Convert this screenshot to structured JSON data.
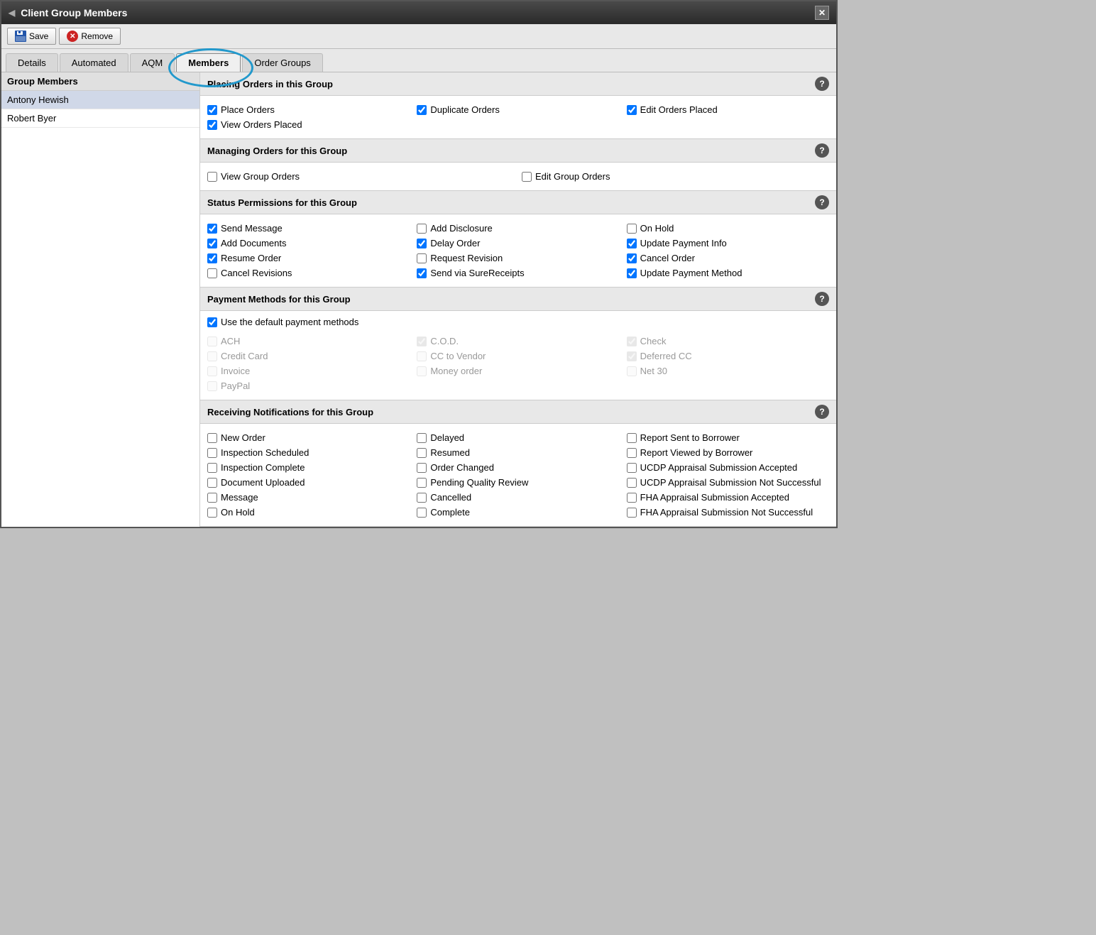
{
  "window": {
    "title": "Client Group Members",
    "close_label": "✕"
  },
  "toolbar": {
    "save_label": "Save",
    "remove_label": "Remove"
  },
  "tabs": [
    {
      "id": "details",
      "label": "Details",
      "active": false
    },
    {
      "id": "automated",
      "label": "Automated",
      "active": false
    },
    {
      "id": "aqm",
      "label": "AQM",
      "active": false
    },
    {
      "id": "members",
      "label": "Members",
      "active": true
    },
    {
      "id": "order-groups",
      "label": "Order Groups",
      "active": false
    }
  ],
  "left_panel": {
    "header": "Group Members",
    "members": [
      {
        "name": "Antony Hewish",
        "selected": true
      },
      {
        "name": "Robert Byer",
        "selected": false
      }
    ]
  },
  "sections": {
    "placing_orders": {
      "title": "Placing Orders in this Group",
      "items": [
        {
          "label": "Place Orders",
          "checked": true,
          "disabled": false
        },
        {
          "label": "Duplicate Orders",
          "checked": true,
          "disabled": false
        },
        {
          "label": "Edit Orders Placed",
          "checked": true,
          "disabled": false
        },
        {
          "label": "View Orders Placed",
          "checked": true,
          "disabled": false
        }
      ]
    },
    "managing_orders": {
      "title": "Managing Orders for this Group",
      "items": [
        {
          "label": "View Group Orders",
          "checked": false,
          "disabled": false
        },
        {
          "label": "Edit Group Orders",
          "checked": false,
          "disabled": false
        }
      ]
    },
    "status_permissions": {
      "title": "Status Permissions for this Group",
      "items": [
        {
          "label": "Send Message",
          "checked": true,
          "disabled": false
        },
        {
          "label": "Add Disclosure",
          "checked": false,
          "disabled": false
        },
        {
          "label": "On Hold",
          "checked": false,
          "disabled": false
        },
        {
          "label": "Add Documents",
          "checked": true,
          "disabled": false
        },
        {
          "label": "Delay Order",
          "checked": true,
          "disabled": false
        },
        {
          "label": "Update Payment Info",
          "checked": true,
          "disabled": false
        },
        {
          "label": "Resume Order",
          "checked": true,
          "disabled": false
        },
        {
          "label": "Request Revision",
          "checked": false,
          "disabled": false
        },
        {
          "label": "Cancel Order",
          "checked": true,
          "disabled": false
        },
        {
          "label": "Cancel Revisions",
          "checked": false,
          "disabled": false
        },
        {
          "label": "Send via SureReceipts",
          "checked": true,
          "disabled": false
        },
        {
          "label": "Update Payment Method",
          "checked": true,
          "disabled": false
        }
      ]
    },
    "payment_methods": {
      "title": "Payment Methods for this Group",
      "use_default": {
        "label": "Use the default payment methods",
        "checked": true
      },
      "items": [
        {
          "label": "ACH",
          "checked": false,
          "disabled": true
        },
        {
          "label": "C.O.D.",
          "checked": true,
          "disabled": true
        },
        {
          "label": "Check",
          "checked": true,
          "disabled": true
        },
        {
          "label": "Credit Card",
          "checked": false,
          "disabled": true
        },
        {
          "label": "CC to Vendor",
          "checked": false,
          "disabled": true
        },
        {
          "label": "Deferred CC",
          "checked": true,
          "disabled": true
        },
        {
          "label": "Invoice",
          "checked": false,
          "disabled": true
        },
        {
          "label": "Money order",
          "checked": false,
          "disabled": true
        },
        {
          "label": "Net 30",
          "checked": false,
          "disabled": true
        },
        {
          "label": "PayPal",
          "checked": false,
          "disabled": true
        }
      ]
    },
    "notifications": {
      "title": "Receiving Notifications for this Group",
      "items": [
        {
          "label": "New Order",
          "checked": false,
          "disabled": false
        },
        {
          "label": "Delayed",
          "checked": false,
          "disabled": false
        },
        {
          "label": "Report Sent to Borrower",
          "checked": false,
          "disabled": false
        },
        {
          "label": "Inspection Scheduled",
          "checked": false,
          "disabled": false
        },
        {
          "label": "Resumed",
          "checked": false,
          "disabled": false
        },
        {
          "label": "Report Viewed by Borrower",
          "checked": false,
          "disabled": false
        },
        {
          "label": "Inspection Complete",
          "checked": false,
          "disabled": false
        },
        {
          "label": "Order Changed",
          "checked": false,
          "disabled": false
        },
        {
          "label": "UCDP Appraisal Submission Accepted",
          "checked": false,
          "disabled": false
        },
        {
          "label": "Document Uploaded",
          "checked": false,
          "disabled": false
        },
        {
          "label": "Pending Quality Review",
          "checked": false,
          "disabled": false
        },
        {
          "label": "UCDP Appraisal Submission Not Successful",
          "checked": false,
          "disabled": false
        },
        {
          "label": "Message",
          "checked": false,
          "disabled": false
        },
        {
          "label": "Cancelled",
          "checked": false,
          "disabled": false
        },
        {
          "label": "FHA Appraisal Submission Accepted",
          "checked": false,
          "disabled": false
        },
        {
          "label": "On Hold",
          "checked": false,
          "disabled": false
        },
        {
          "label": "Complete",
          "checked": false,
          "disabled": false
        },
        {
          "label": "FHA Appraisal Submission Not Successful",
          "checked": false,
          "disabled": false
        }
      ]
    }
  },
  "help_icon": "?"
}
